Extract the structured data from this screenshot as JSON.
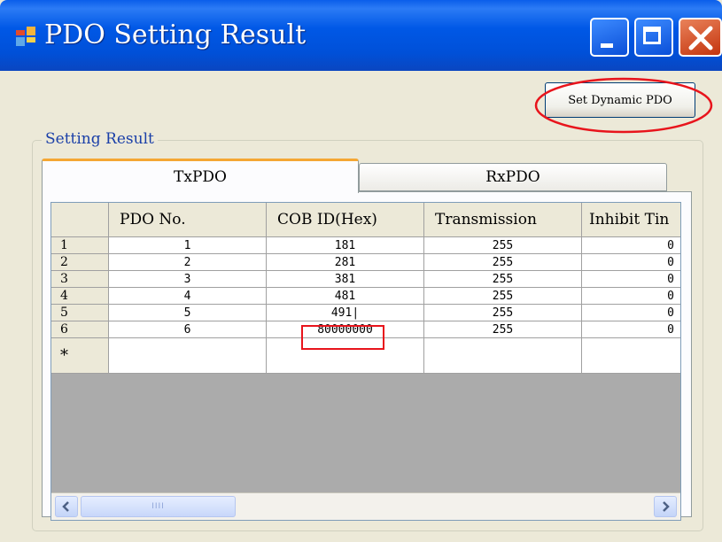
{
  "window": {
    "title": "PDO Setting Result",
    "accent_color": "#0058E6",
    "close_color": "#D2441C"
  },
  "toolbar": {
    "dynamic_button_label": "Set Dynamic PDO"
  },
  "group": {
    "label": "Setting Result"
  },
  "tabs": [
    {
      "label": "TxPDO",
      "active": true
    },
    {
      "label": "RxPDO",
      "active": false
    }
  ],
  "grid": {
    "columns": [
      "PDO No.",
      "COB ID(Hex)",
      "Transmission",
      "Inhibit Tin"
    ],
    "rows": [
      {
        "header": "1",
        "cells": [
          "1",
          "181",
          "255",
          "0"
        ]
      },
      {
        "header": "2",
        "cells": [
          "2",
          "281",
          "255",
          "0"
        ]
      },
      {
        "header": "3",
        "cells": [
          "3",
          "381",
          "255",
          "0"
        ]
      },
      {
        "header": "4",
        "cells": [
          "4",
          "481",
          "255",
          "0"
        ]
      },
      {
        "header": "5",
        "cells": [
          "5",
          "491|",
          "255",
          "0"
        ]
      },
      {
        "header": "6",
        "cells": [
          "6",
          "80000000",
          "255",
          "0"
        ]
      }
    ],
    "new_row_marker": "*"
  },
  "scrollbar": {
    "thumb_grip": "IIII"
  }
}
